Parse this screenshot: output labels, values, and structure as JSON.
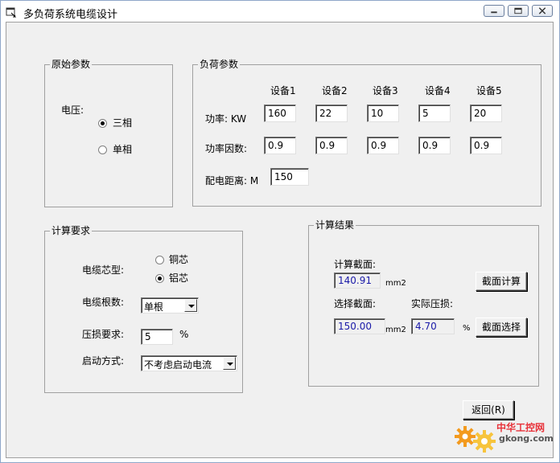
{
  "window": {
    "title": "多负荷系统电缆设计"
  },
  "original": {
    "title": "原始参数",
    "voltage_label": "电压:",
    "options": [
      "三相",
      "单相"
    ],
    "selected": 0
  },
  "load": {
    "title": "负荷参数",
    "devices": [
      "设备1",
      "设备2",
      "设备3",
      "设备4",
      "设备5"
    ],
    "power_label": "功率: KW",
    "power_values": [
      "160",
      "22",
      "10",
      "5",
      "20"
    ],
    "pf_label": "功率因数:",
    "pf_values": [
      "0.9",
      "0.9",
      "0.9",
      "0.9",
      "0.9"
    ],
    "distance_label": "配电距离: M",
    "distance_value": "150"
  },
  "requirements": {
    "title": "计算要求",
    "core_label": "电缆芯型:",
    "core_options": [
      "铜芯",
      "铝芯"
    ],
    "core_selected": 1,
    "count_label": "电缆根数:",
    "count_value": "单根",
    "drop_label": "压损要求:",
    "drop_value": "5",
    "drop_unit": "%",
    "start_label": "启动方式:",
    "start_value": "不考虑启动电流"
  },
  "results": {
    "title": "计算结果",
    "calc_section_label": "计算截面:",
    "calc_section_value": "140.91",
    "unit_mm2": "mm2",
    "calc_button": "截面计算",
    "select_section_label": "选择截面:",
    "select_section_value": "150.00",
    "actual_drop_label": "实际压损:",
    "actual_drop_value": "4.70",
    "actual_drop_unit": "%",
    "select_button": "截面选择"
  },
  "footer": {
    "return_button": "返回(R)"
  },
  "watermark": {
    "line1": "中华工控网",
    "line2": "gkong.com"
  }
}
